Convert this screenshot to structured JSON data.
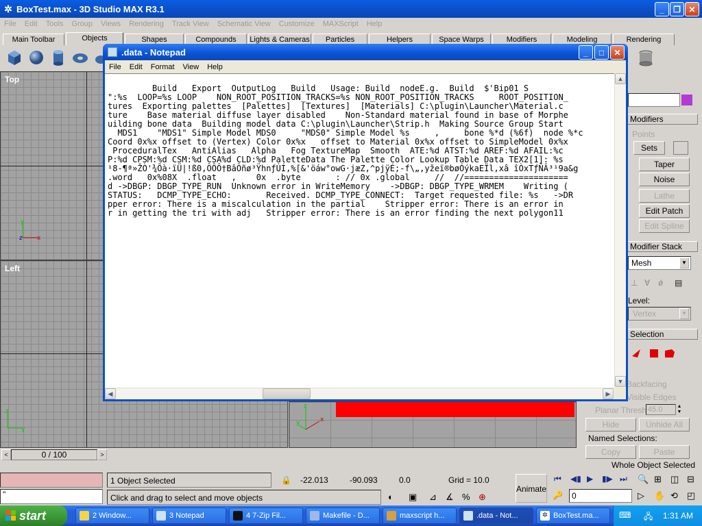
{
  "max": {
    "title": "BoxTest.max - 3D Studio MAX R3.1",
    "menu": [
      "File",
      "Edit",
      "Tools",
      "Group",
      "Views",
      "Rendering",
      "Track View",
      "Schematic View",
      "Customize",
      "MAXScript",
      "Help"
    ],
    "tabs": [
      "Main Toolbar",
      "Objects",
      "Shapes",
      "Compounds",
      "Lights & Cameras",
      "Particles",
      "Helpers",
      "Space Warps",
      "Modifiers",
      "Modeling",
      "Rendering"
    ],
    "viewports": {
      "top": "Top",
      "left": "Left"
    },
    "time_slider": "0 / 100",
    "status": {
      "selection": "1 Object Selected",
      "prompt": "Click and drag to select and move objects",
      "x": "-22.013",
      "y": "-90.093",
      "z": "0.0",
      "grid": "Grid = 10.0",
      "animate": "Animate",
      "frame": "0",
      "maxscript_prompt": "\""
    },
    "panel": {
      "modifiers_header": "Modifiers",
      "points": "Points",
      "sets": "Sets",
      "taper": "Taper",
      "noise": "Noise",
      "lathe": "Lathe",
      "edit_patch": "Edit Patch",
      "edit_spline": "Edit Spline",
      "modifier_stack_header": "Modifier Stack",
      "stack_value": "Mesh",
      "sub_object_label": "Level:",
      "sub_object_value": "Vertex",
      "selection_header": "Selection",
      "backfacing": "Backfacing",
      "visible_edges": "Visible Edges",
      "planar_thresh": "Planar Thresh",
      "planar_value": "45.0",
      "hide": "Hide",
      "unhide_all": "Unhide All",
      "named_selections": "Named Selections:",
      "copy": "Copy",
      "paste": "Paste",
      "whole_object": "Whole Object Selected"
    }
  },
  "notepad": {
    "title": ".data - Notepad",
    "menu": [
      "File",
      "Edit",
      "Format",
      "View",
      "Help"
    ],
    "lines": [
      "         Build   Export  OutputLog   Build   Usage: Build  nodeE.g.  Build  $'Bip01 S",
      "\":%s  LOOP=%s LOOP    NON_ROOT_POSITION_TRACKS=%s NON_ROOT_POSITION_TRACKS     ROOT_POSITION_",
      "tures  Exporting palettes  [Palettes]  [Textures]  [Materials] C:\\plugin\\Launcher\\Material.c",
      "ture    Base material diffuse layer disabled    Non-Standard material found in base of Morphe",
      "uilding bone data  Building model data C:\\plugin\\Launcher\\Strip.h  Making Source Group Start",
      "  MDS1    \"MDS1\" Simple Model MDS0     \"MDS0\" Simple Model %s     ,     bone %*d (%6f)  node %*c",
      "Coord 0x%x offset to (Vertex) Color 0x%x   offset to Material 0x%x offset to SimpleModel 0x%x",
      " ProceduralTex   AntiAlias   Alpha   Fog TextureMap  Smooth  ATE:%d ATST:%d AREF:%d AFAIL:%c",
      "P:%d CPSM:%d CSM:%d CSA%d CLD:%d PaletteData The Palette Color Lookup Table Data TEX2[1]: %s",
      "¹8-¶ª»ŽÒ'¾Õà·ïÜ|!ß0,ÔÔÔ†BâÔñø³ŸhnƒÚÍ,%[&'öáw°owG·jæZ‚^pjÿÉ;-f\\„‚yžeï®bøÓýkaEÏl,xâ îÒxTƒÑÂ³¹9a&g",
      ".word   0x%08X  .float   ,    0x  .byte       : // 0x .global     //  //=====================",
      "d ->DBGP: DBGP_TYPE_RUN  Unknown error in WriteMemory    ->DBGP: DBGP_TYPE_WRMEM    Writing (",
      "STATUS:   DCMP_TYPE_ECHO:       Received. DCMP_TYPE_CONNECT:  Target requested file: %s   ->DR",
      "pper error: There is a miscalculation in the partial    Stripper error: There is an error in",
      "r in getting the tri with adj   Stripper error: There is an error finding the next polygon11"
    ]
  },
  "taskbar": {
    "start": "start",
    "buttons": [
      "2 Window...",
      "3 Notepad",
      "4 7-Zip Fil...",
      "Makefile - D...",
      "maxscript h...",
      ".data - Not...",
      "BoxTest.ma..."
    ],
    "clock": "1:31 AM"
  }
}
